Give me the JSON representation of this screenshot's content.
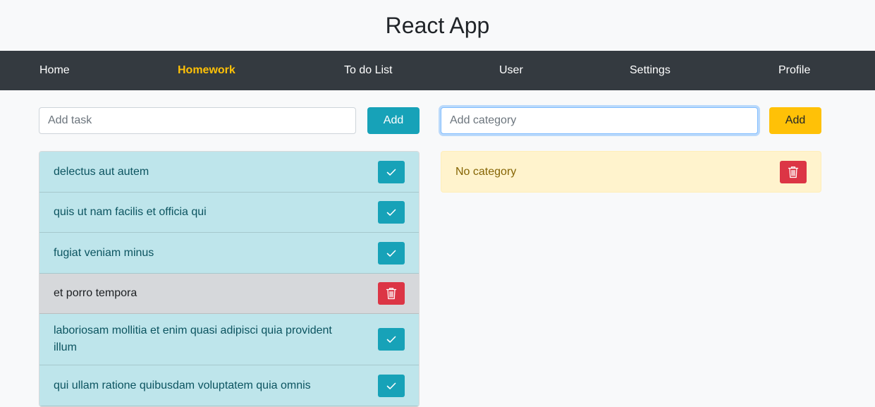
{
  "app": {
    "title": "React App"
  },
  "nav": {
    "items": [
      {
        "label": "Home"
      },
      {
        "label": "Homework"
      },
      {
        "label": "To do List"
      },
      {
        "label": "User"
      },
      {
        "label": "Settings"
      },
      {
        "label": "Profile"
      }
    ],
    "active": "Homework",
    "active_color": "#ffc107",
    "background": "#343a40"
  },
  "tasks": {
    "input_placeholder": "Add task",
    "input_value": "",
    "add_label": "Add",
    "items": [
      {
        "text": "delectus aut autem",
        "status": "completed",
        "action_icon": "check-icon"
      },
      {
        "text": "quis ut nam facilis et officia qui",
        "status": "completed",
        "action_icon": "check-icon"
      },
      {
        "text": "fugiat veniam minus",
        "status": "completed",
        "action_icon": "check-icon"
      },
      {
        "text": "et porro tempora",
        "status": "deletable",
        "action_icon": "trash-icon"
      },
      {
        "text": "laboriosam mollitia et enim quasi adipisci quia provident illum",
        "status": "completed",
        "action_icon": "check-icon"
      },
      {
        "text": "qui ullam ratione quibusdam voluptatem quia omnis",
        "status": "completed",
        "action_icon": "check-icon"
      }
    ]
  },
  "categories": {
    "input_placeholder": "Add category",
    "input_value": "",
    "add_label": "Add",
    "items": [
      {
        "text": "No category",
        "action_icon": "trash-icon"
      }
    ]
  },
  "colors": {
    "info": "#17a2b8",
    "warning": "#ffc107",
    "danger": "#dc3545"
  }
}
